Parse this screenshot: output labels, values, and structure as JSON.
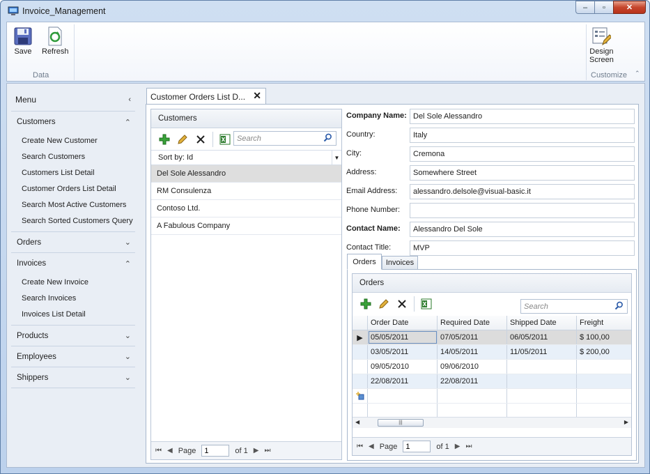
{
  "window": {
    "title": "Invoice_Management",
    "min": "‒",
    "max": "▫",
    "close": "✕"
  },
  "ribbon": {
    "save": "Save",
    "refresh": "Refresh",
    "data_group": "Data",
    "design_line1": "Design",
    "design_line2": "Screen",
    "customize_group": "Customize"
  },
  "menu": {
    "title": "Menu",
    "groups": [
      {
        "label": "Customers",
        "items": [
          "Create New Customer",
          "Search Customers",
          "Customers List Detail",
          "Customer Orders List Detail",
          "Search Most Active Customers",
          "Search Sorted Customers Query"
        ]
      },
      {
        "label": "Orders"
      },
      {
        "label": "Invoices",
        "items": [
          "Create New Invoice",
          "Search Invoices",
          "Invoices List Detail"
        ]
      },
      {
        "label": "Products"
      },
      {
        "label": "Employees"
      },
      {
        "label": "Shippers"
      }
    ]
  },
  "tab": {
    "label": "Customer Orders List D...",
    "close": "✕"
  },
  "customers": {
    "header": "Customers",
    "search_placeholder": "Search",
    "sort": "Sort by: Id",
    "items": [
      "Del Sole Alessandro",
      "RM Consulenza",
      "Contoso Ltd.",
      "A Fabulous Company"
    ],
    "pager": {
      "page_label": "Page",
      "page": "1",
      "of": "of 1"
    }
  },
  "details": {
    "fields": [
      {
        "label": "Company Name:",
        "value": "Del Sole Alessandro",
        "bold": true
      },
      {
        "label": "Country:",
        "value": "Italy"
      },
      {
        "label": "City:",
        "value": "Cremona"
      },
      {
        "label": "Address:",
        "value": "Somewhere Street"
      },
      {
        "label": "Email Address:",
        "value": "alessandro.delsole@visual-basic.it"
      },
      {
        "label": "Phone Number:",
        "value": ""
      },
      {
        "label": "Contact Name:",
        "value": "Alessandro Del Sole",
        "bold": true
      },
      {
        "label": "Contact Title:",
        "value": "MVP"
      }
    ]
  },
  "subtabs": {
    "orders": "Orders",
    "invoices": "Invoices"
  },
  "orders": {
    "header": "Orders",
    "search_placeholder": "Search",
    "columns": [
      "Order Date",
      "Required Date",
      "Shipped Date",
      "Freight"
    ],
    "rows": [
      [
        "05/05/2011",
        "07/05/2011",
        "06/05/2011",
        "$ 100,00"
      ],
      [
        "03/05/2011",
        "14/05/2011",
        "11/05/2011",
        "$ 200,00"
      ],
      [
        "09/05/2010",
        "09/06/2010",
        "",
        ""
      ],
      [
        "22/08/2011",
        "22/08/2011",
        "",
        ""
      ]
    ],
    "pager": {
      "page_label": "Page",
      "page": "1",
      "of": "of 1"
    }
  }
}
